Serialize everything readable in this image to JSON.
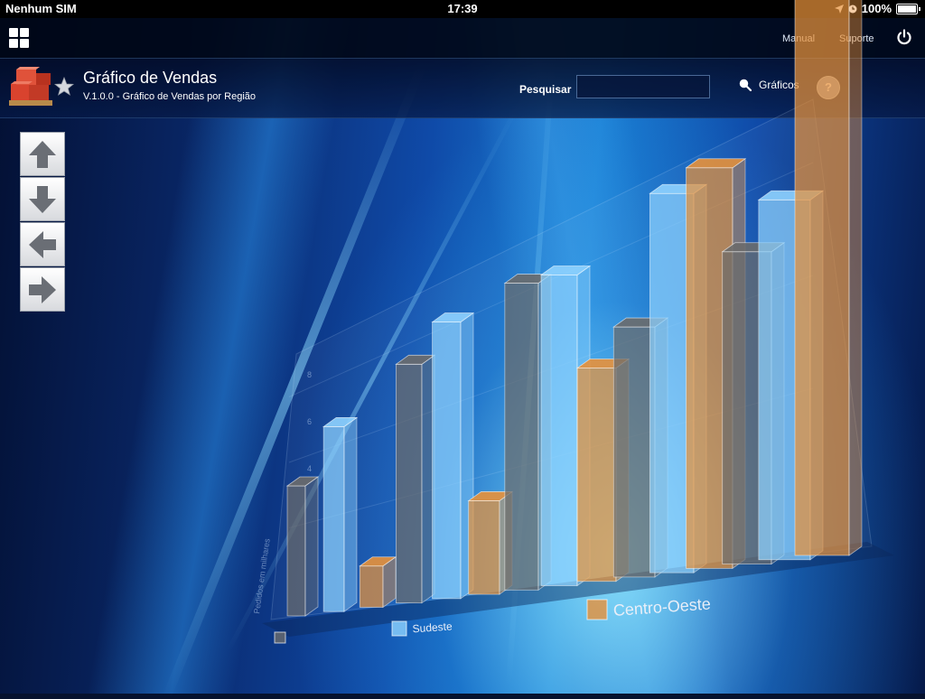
{
  "status_bar": {
    "carrier": "Nenhum SIM",
    "time": "17:39",
    "battery": "100%"
  },
  "top_nav": {
    "manual": "Manual",
    "suporte": "Suporte"
  },
  "header": {
    "title": "Gráfico de Vendas",
    "subtitle": "V.1.0.0 - Gráfico de Vendas por Região",
    "search_label": "Pesquisar",
    "search_value": "",
    "graficos_label": "Gráficos",
    "help_label": "?"
  },
  "icons": [
    "apps-grid-icon",
    "power-icon",
    "boxes-logo-icon",
    "star-icon",
    "search-icon",
    "arrow-up-icon",
    "arrow-down-icon",
    "arrow-left-icon",
    "arrow-right-icon"
  ],
  "colors": {
    "series_dark": "#6b6b6b",
    "series_light": "#8fd3ff",
    "series_orange": "#e8913a",
    "accent": "#1a7fd4"
  },
  "chart_data": {
    "type": "bar",
    "subtype": "3d-perspective",
    "title": "",
    "ylabel": "Pedidos em milhares",
    "ylim": [
      0,
      8
    ],
    "yticks": [
      "4",
      "6",
      "8"
    ],
    "categories": [
      "",
      "",
      "",
      "",
      ""
    ],
    "series": [
      {
        "name": "",
        "values": [
          4.5,
          7.2,
          8.2,
          6.0,
          6.8
        ],
        "color": "#6b6b6b"
      },
      {
        "name": "Sudeste",
        "values": [
          6.1,
          8.0,
          8.0,
          8.8,
          7.6
        ],
        "color": "#8fd3ff"
      },
      {
        "name": "Centro-Oeste",
        "values": [
          1.3,
          2.6,
          5.3,
          9.0,
          16.5
        ],
        "color": "#e8913a"
      }
    ],
    "legend": [
      "",
      "Sudeste",
      "Centro-Oeste"
    ],
    "legend_position": "bottom"
  }
}
